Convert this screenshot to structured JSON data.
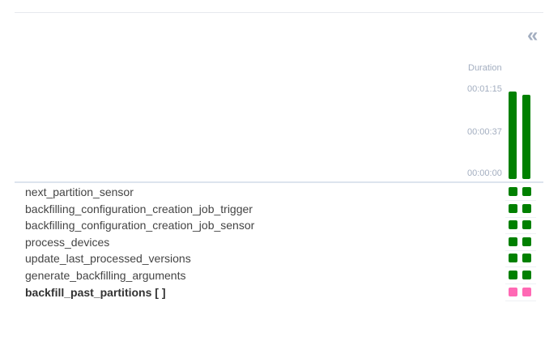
{
  "panel": {
    "duration_label": "Duration",
    "axis_ticks": [
      "00:01:15",
      "00:00:37",
      "00:00:00"
    ],
    "collapse_icon": "double-chevron-left-icon"
  },
  "runs": [
    {
      "duration_fraction": 1.0,
      "state": "success"
    },
    {
      "duration_fraction": 0.96,
      "state": "success"
    }
  ],
  "colors": {
    "success": "#008000",
    "up_for_reschedule": "#ff69b4",
    "muted": "#a3aec0"
  },
  "tasks": [
    {
      "name": "next_partition_sensor",
      "group": false,
      "states": [
        "success",
        "success"
      ]
    },
    {
      "name": "backfilling_configuration_creation_job_trigger",
      "group": false,
      "states": [
        "success",
        "success"
      ]
    },
    {
      "name": "backfilling_configuration_creation_job_sensor",
      "group": false,
      "states": [
        "success",
        "success"
      ]
    },
    {
      "name": "process_devices",
      "group": false,
      "states": [
        "success",
        "success"
      ]
    },
    {
      "name": "update_last_processed_versions",
      "group": false,
      "states": [
        "success",
        "success"
      ]
    },
    {
      "name": "generate_backfilling_arguments",
      "group": false,
      "states": [
        "success",
        "success"
      ]
    },
    {
      "name": "backfill_past_partitions [ ]",
      "group": true,
      "states": [
        "up_for_reschedule",
        "up_for_reschedule"
      ]
    }
  ]
}
